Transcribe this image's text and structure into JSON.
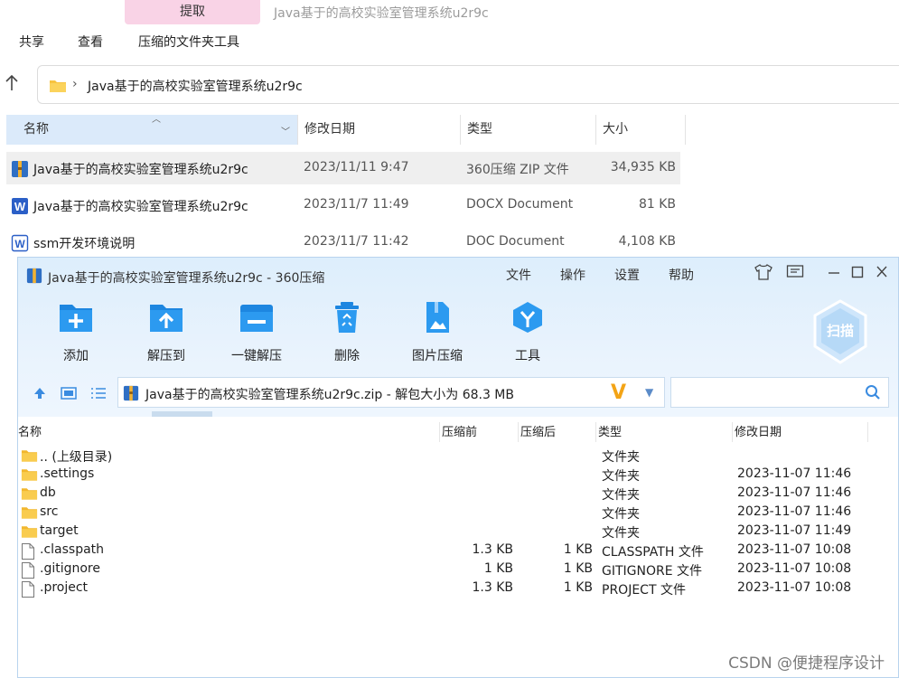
{
  "explorer": {
    "context_tab": "提取",
    "title": "Java基于的高校实验室管理系统u2r9c",
    "menu": [
      "共享",
      "查看",
      "压缩的文件夹工具"
    ],
    "address_path": "Java基于的高校实验室管理系统u2r9c",
    "columns": {
      "name": "名称",
      "date": "修改日期",
      "type": "类型",
      "size": "大小"
    },
    "rows": [
      {
        "name": "Java基于的高校实验室管理系统u2r9c",
        "date": "2023/11/11 9:47",
        "type": "360压缩 ZIP 文件",
        "size": "34,935 KB",
        "icon": "zip-archive-icon"
      },
      {
        "name": "Java基于的高校实验室管理系统u2r9c",
        "date": "2023/11/7 11:49",
        "type": "DOCX Document",
        "size": "81 KB",
        "icon": "word-doc-icon"
      },
      {
        "name": "ssm开发环境说明",
        "date": "2023/11/7 11:42",
        "type": "DOC Document",
        "size": "4,108 KB",
        "icon": "word-doc-icon"
      }
    ]
  },
  "zip_window": {
    "title": "Java基于的高校实验室管理系统u2r9c - 360压缩",
    "menu": [
      "文件",
      "操作",
      "设置",
      "帮助"
    ],
    "tools": [
      "添加",
      "解压到",
      "一键解压",
      "删除",
      "图片压缩",
      "工具"
    ],
    "scan_label": "扫描",
    "path": "Java基于的高校实验室管理系统u2r9c.zip - 解包大小为 68.3 MB",
    "columns": {
      "name": "名称",
      "before": "压缩前",
      "after": "压缩后",
      "type": "类型",
      "date": "修改日期"
    },
    "rows": [
      {
        "name": ".. (上级目录)",
        "before": "",
        "after": "",
        "type": "文件夹",
        "date": "",
        "icon": "folder"
      },
      {
        "name": ".settings",
        "before": "",
        "after": "",
        "type": "文件夹",
        "date": "2023-11-07 11:46",
        "icon": "folder"
      },
      {
        "name": "db",
        "before": "",
        "after": "",
        "type": "文件夹",
        "date": "2023-11-07 11:46",
        "icon": "folder"
      },
      {
        "name": "src",
        "before": "",
        "after": "",
        "type": "文件夹",
        "date": "2023-11-07 11:46",
        "icon": "folder"
      },
      {
        "name": "target",
        "before": "",
        "after": "",
        "type": "文件夹",
        "date": "2023-11-07 11:49",
        "icon": "folder"
      },
      {
        "name": ".classpath",
        "before": "1.3 KB",
        "after": "1 KB",
        "type": "CLASSPATH 文件",
        "date": "2023-11-07 10:08",
        "icon": "file"
      },
      {
        "name": ".gitignore",
        "before": "1 KB",
        "after": "1 KB",
        "type": "GITIGNORE 文件",
        "date": "2023-11-07 10:08",
        "icon": "file"
      },
      {
        "name": ".project",
        "before": "1.3 KB",
        "after": "1 KB",
        "type": "PROJECT 文件",
        "date": "2023-11-07 10:08",
        "icon": "file"
      }
    ]
  },
  "watermark": "CSDN @便捷程序设计",
  "colors": {
    "accent": "#1a8ae6",
    "folder": "#f7c340",
    "selection": "#dbeafa"
  }
}
